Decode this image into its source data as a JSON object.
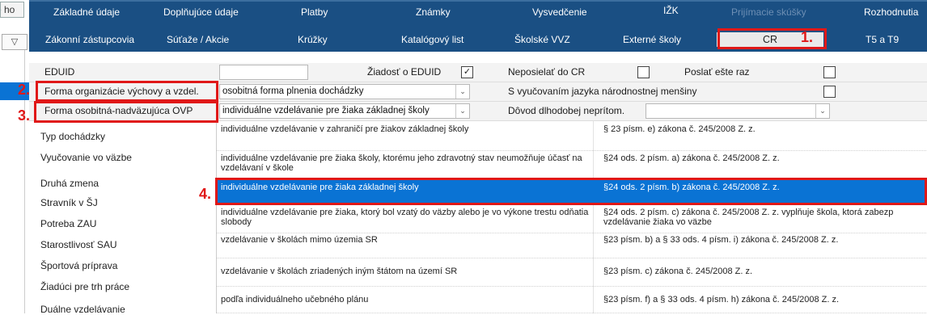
{
  "left_strip": {
    "tab_text": "e ho",
    "filter_icon": "filter-icon"
  },
  "tabs_row1": [
    "Základné údaje",
    "Doplňujúce údaje",
    "Platby",
    "Známky",
    "Vysvedčenie",
    "IŽK",
    "Prijímacie skúšky",
    "Rozhodnutia"
  ],
  "tabs_row2": [
    "Zákonní zástupcovia",
    "Súťaže / Akcie",
    "Krúžky",
    "Katalógový list",
    "Školské VVZ",
    "Externé školy",
    "CR",
    "T5 a T9"
  ],
  "form": {
    "eduid_label": "EDUID",
    "eduid_value": "",
    "ziadost_label": "Žiadosť o EDUID",
    "ziadost_checked": "✓",
    "neposielat_label": "Neposielať do CR",
    "poslat_label": "Poslať ešte raz",
    "forma_org_label": "Forma organizácie výchovy a vzdel.",
    "forma_org_value": "osobitná forma plnenia dochádzky",
    "s_vyucovanim_label": "S vyučovaním jazyka národnostnej menšiny",
    "forma_osob_label": "Forma osobitná-nadväzujúca OVP",
    "forma_osob_value": "individuálne vzdelávanie pre žiaka základnej školy",
    "dovod_label": "Dôvod dlhodobej neprítom."
  },
  "left_items": [
    "Typ dochádzky",
    "Vyučovanie vo väzbe",
    "Druhá zmena",
    "Stravník v ŠJ",
    "Potreba ZAU",
    "Starostlivosť SAU",
    "Športová príprava",
    "Žiadúci pre trh práce",
    "Duálne vzdelávanie"
  ],
  "dropdown_rows": [
    {
      "name": "individuálne vzdelávanie v zahraničí pre žiakov základnej školy",
      "law": "§ 23 písm. e) zákona č. 245/2008 Z. z."
    },
    {
      "name": "individuálne vzdelávanie pre žiaka školy, ktorému jeho zdravotný stav neumožňuje účasť na vzdelávaní v škole",
      "law": "§24 ods. 2 písm. a) zákona č. 245/2008 Z. z."
    },
    {
      "name": "individuálne vzdelávanie pre žiaka základnej školy",
      "law": "§24 ods. 2 písm. b) zákona č. 245/2008 Z. z."
    },
    {
      "name": "individuálne vzdelávanie pre žiaka, ktorý bol vzatý do väzby alebo je vo výkone trestu odňatia slobody",
      "law": "§24 ods. 2 písm. c) zákona č. 245/2008 Z. z.  vyplňuje škola, ktorá zabezp vzdelávanie žiaka vo väzbe"
    },
    {
      "name": "vzdelávanie v školách mimo územia SR",
      "law": "§23 písm. b) a § 33 ods. 4 písm. i) zákona č. 245/2008 Z. z."
    },
    {
      "name": "vzdelávanie v školách zriadených iným štátom na území SR",
      "law": "§23 písm. c)  zákona č. 245/2008 Z. z."
    },
    {
      "name": "podľa individuálneho učebného plánu",
      "law": "§23 písm. f)  a § 33 ods. 4 písm. h) zákona č. 245/2008 Z. z."
    }
  ],
  "annotations": [
    "1.",
    "2.",
    "3.",
    "4."
  ],
  "colors": {
    "tab_bar": "#1a4f83",
    "selection": "#0a73d4",
    "annotation": "#e01818"
  }
}
